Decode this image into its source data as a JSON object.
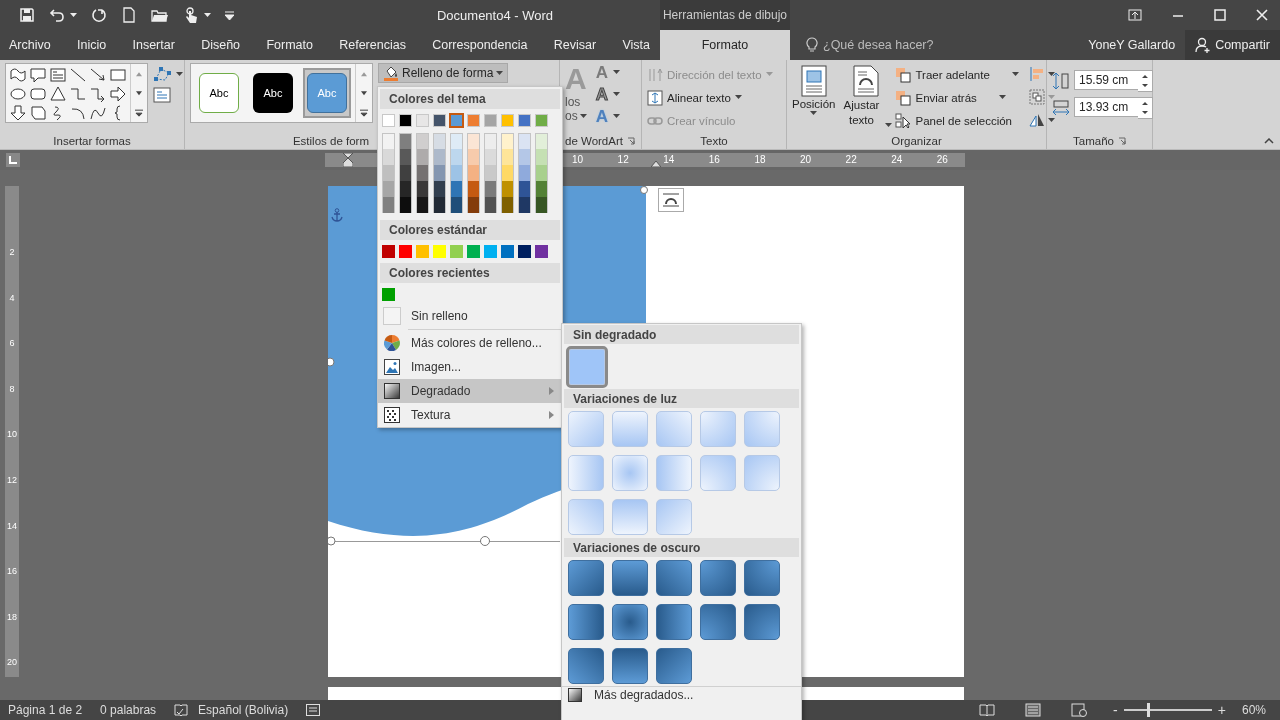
{
  "title_bar": {
    "title": "Documento4 - Word",
    "context_label": "Herramientas de dibujo"
  },
  "tabs": [
    {
      "label": "Archivo",
      "selected": false,
      "contextual": false
    },
    {
      "label": "Inicio",
      "selected": false,
      "contextual": false
    },
    {
      "label": "Insertar",
      "selected": false,
      "contextual": false
    },
    {
      "label": "Diseño",
      "selected": false,
      "contextual": false
    },
    {
      "label": "Formato",
      "selected": false,
      "contextual": false
    },
    {
      "label": "Referencias",
      "selected": false,
      "contextual": false
    },
    {
      "label": "Correspondencia",
      "selected": false,
      "contextual": false
    },
    {
      "label": "Revisar",
      "selected": false,
      "contextual": false
    },
    {
      "label": "Vista",
      "selected": false,
      "contextual": false
    },
    {
      "label": "Formato",
      "selected": true,
      "contextual": true
    }
  ],
  "tell_me": {
    "placeholder": "¿Qué desea hacer?"
  },
  "user": "YoneY Gallardo",
  "share_button": "Compartir",
  "ribbon": {
    "insert_shapes": {
      "label": "Insertar formas"
    },
    "shape_styles": {
      "label": "Estilos de form",
      "fill_button": "Relleno de forma",
      "styles": [
        {
          "text": "Abc",
          "kind": "outline",
          "selected": false
        },
        {
          "text": "Abc",
          "kind": "dark",
          "selected": false
        },
        {
          "text": "Abc",
          "kind": "accent",
          "selected": true
        }
      ]
    },
    "wordart": {
      "label": "de WordArt",
      "quick_styles_glyph": "A",
      "fragments": [
        "los",
        "os"
      ],
      "buttons": [
        {
          "glyph": "A",
          "kind": "fill"
        },
        {
          "glyph": "A",
          "kind": "outline"
        },
        {
          "glyph": "A",
          "kind": "effects"
        }
      ]
    },
    "text": {
      "label": "Texto",
      "items": [
        {
          "label": "Dirección del texto",
          "disabled": true
        },
        {
          "label": "Alinear texto",
          "disabled": false
        },
        {
          "label": "Crear vínculo",
          "disabled": true
        }
      ]
    },
    "arrange": {
      "label": "Organizar",
      "position": "Posición",
      "wrap": "Ajustar texto",
      "items": [
        "Traer adelante",
        "Enviar atrás",
        "Panel de selección"
      ]
    },
    "size": {
      "label": "Tamaño",
      "height": "15.59 cm",
      "width": "13.93 cm"
    }
  },
  "horizontal_ruler": {
    "labels": [
      "10",
      "12",
      "14",
      "16",
      "18",
      "20",
      "22",
      "24",
      "26"
    ]
  },
  "vertical_ruler": {
    "labels": [
      "2",
      "4",
      "6",
      "8",
      "10",
      "12",
      "14",
      "16",
      "18",
      "20"
    ]
  },
  "fill_menu": {
    "theme_header": "Colores del tema",
    "theme_colors": [
      {
        "color": "#ffffff",
        "selected": false
      },
      {
        "color": "#000000",
        "selected": false
      },
      {
        "color": "#e7e6e6",
        "selected": false
      },
      {
        "color": "#44546a",
        "selected": false
      },
      {
        "color": "#5b9bd5",
        "selected": true
      },
      {
        "color": "#ed7d31",
        "selected": false
      },
      {
        "color": "#a5a5a5",
        "selected": false
      },
      {
        "color": "#ffc000",
        "selected": false
      },
      {
        "color": "#4472c4",
        "selected": false
      },
      {
        "color": "#70ad47",
        "selected": false
      }
    ],
    "theme_shades": [
      [
        {
          "color": "#f2f2f2"
        },
        {
          "color": "#d9d9d9"
        },
        {
          "color": "#bfbfbf"
        },
        {
          "color": "#a6a6a6"
        },
        {
          "color": "#808080"
        }
      ],
      [
        {
          "color": "#7f7f7f"
        },
        {
          "color": "#595959"
        },
        {
          "color": "#404040"
        },
        {
          "color": "#262626"
        },
        {
          "color": "#0d0d0d"
        }
      ],
      [
        {
          "color": "#d0cece"
        },
        {
          "color": "#aeabab"
        },
        {
          "color": "#757171"
        },
        {
          "color": "#3a3838"
        },
        {
          "color": "#171616"
        }
      ],
      [
        {
          "color": "#d6dce4"
        },
        {
          "color": "#adb9ca"
        },
        {
          "color": "#8496b0"
        },
        {
          "color": "#323f4f"
        },
        {
          "color": "#222a35"
        }
      ],
      [
        {
          "color": "#deebf6"
        },
        {
          "color": "#bdd7ee"
        },
        {
          "color": "#9dc3e6"
        },
        {
          "color": "#2e75b5"
        },
        {
          "color": "#1f4e79"
        }
      ],
      [
        {
          "color": "#fbe5d5"
        },
        {
          "color": "#f7cbac"
        },
        {
          "color": "#f4b183"
        },
        {
          "color": "#c55a11"
        },
        {
          "color": "#843c0b"
        }
      ],
      [
        {
          "color": "#ededed"
        },
        {
          "color": "#dbdbdb"
        },
        {
          "color": "#c9c9c9"
        },
        {
          "color": "#7b7b7b"
        },
        {
          "color": "#525252"
        }
      ],
      [
        {
          "color": "#fff2cc"
        },
        {
          "color": "#fee599"
        },
        {
          "color": "#ffd965"
        },
        {
          "color": "#bf9000"
        },
        {
          "color": "#7f6000"
        }
      ],
      [
        {
          "color": "#dae3f3"
        },
        {
          "color": "#b4c7e7"
        },
        {
          "color": "#8faadc"
        },
        {
          "color": "#2f5496"
        },
        {
          "color": "#1f3864"
        }
      ],
      [
        {
          "color": "#e2efd9"
        },
        {
          "color": "#c5e0b3"
        },
        {
          "color": "#a8d08d"
        },
        {
          "color": "#538135"
        },
        {
          "color": "#375623"
        }
      ]
    ],
    "standard_header": "Colores estándar",
    "standard_colors": [
      {
        "color": "#c00000"
      },
      {
        "color": "#ff0000"
      },
      {
        "color": "#ffc000"
      },
      {
        "color": "#ffff00"
      },
      {
        "color": "#92d050"
      },
      {
        "color": "#00b050"
      },
      {
        "color": "#00b0f0"
      },
      {
        "color": "#0070c0"
      },
      {
        "color": "#002060"
      },
      {
        "color": "#7030a0"
      }
    ],
    "recent_header": "Colores recientes",
    "recent_colors": [
      {
        "color": "#00a000"
      }
    ],
    "items": [
      {
        "kind": "no-fill",
        "label": "Sin relleno",
        "selected": false,
        "submenu": false
      },
      {
        "kind": "more-colors",
        "label": "Más colores de relleno...",
        "selected": false,
        "submenu": false
      },
      {
        "kind": "picture",
        "label": "Imagen...",
        "selected": false,
        "submenu": false
      },
      {
        "kind": "gradient",
        "label": "Degradado",
        "selected": true,
        "submenu": true
      },
      {
        "kind": "texture",
        "label": "Textura",
        "selected": false,
        "submenu": true
      }
    ]
  },
  "gradient_menu": {
    "sections": [
      {
        "title": "Sin degradado",
        "kind": "none",
        "tiles": [
          {
            "selected": true
          }
        ]
      },
      {
        "title": "Variaciones de luz",
        "kind": "light",
        "tiles": [
          {
            "selected": false
          },
          {
            "selected": false
          },
          {
            "selected": false
          },
          {
            "selected": false
          },
          {
            "selected": false
          },
          {
            "selected": false
          },
          {
            "selected": false
          },
          {
            "selected": false
          },
          {
            "selected": false
          },
          {
            "selected": false
          },
          {
            "selected": false
          },
          {
            "selected": false
          },
          {
            "selected": false
          }
        ]
      },
      {
        "title": "Variaciones de oscuro",
        "kind": "dark",
        "tiles": [
          {
            "selected": false
          },
          {
            "selected": false
          },
          {
            "selected": false
          },
          {
            "selected": false
          },
          {
            "selected": false
          },
          {
            "selected": false
          },
          {
            "selected": false
          },
          {
            "selected": false
          },
          {
            "selected": false
          },
          {
            "selected": false
          },
          {
            "selected": false
          },
          {
            "selected": false
          },
          {
            "selected": false
          }
        ]
      }
    ],
    "more": "Más degradados..."
  },
  "status_bar": {
    "page": "Página 1 de 2",
    "words": "0 palabras",
    "language": "Español (Bolivia)",
    "zoom": {
      "minus": "-",
      "plus": "+",
      "level": 0.27,
      "percent": "60%"
    }
  }
}
